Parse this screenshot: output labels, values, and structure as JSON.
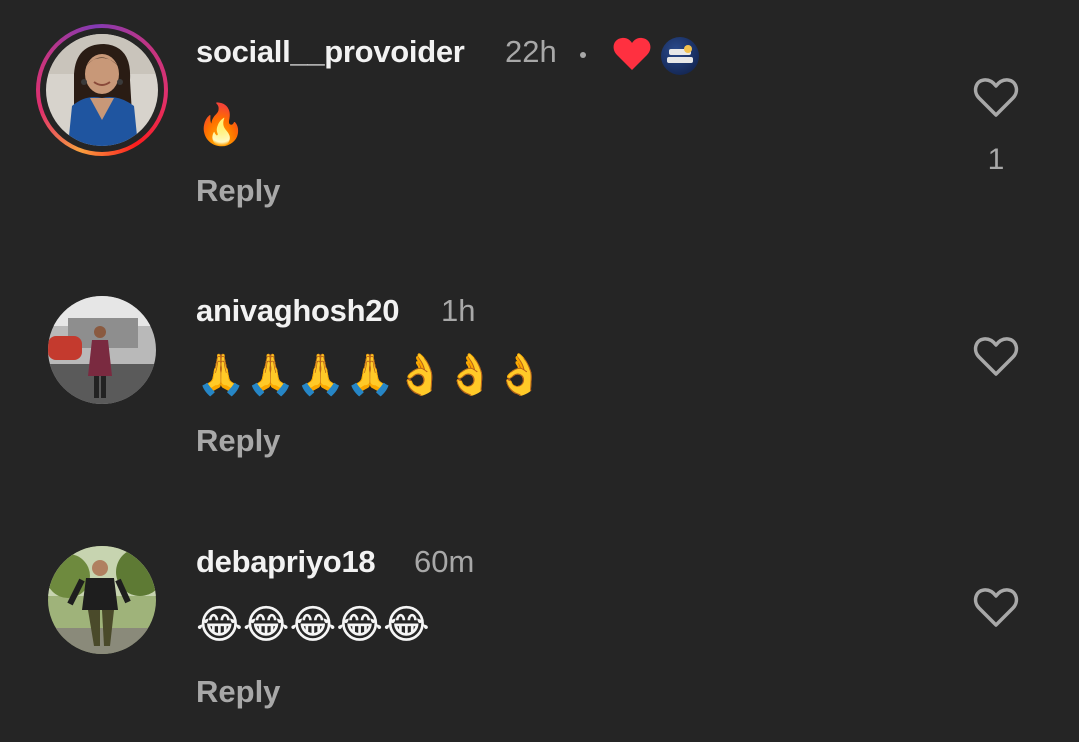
{
  "comments": [
    {
      "username": "sociall__provoider",
      "time": "22h",
      "text": "🔥",
      "reply_label": "Reply",
      "like_count": "1",
      "liked_by_creator": true
    },
    {
      "username": "anivaghosh20",
      "time": "1h",
      "text": "🙏🙏🙏🙏👌👌👌",
      "reply_label": "Reply",
      "like_count": ""
    },
    {
      "username": "debapriyo18",
      "time": "60m",
      "text": "😂😂😂😂😂",
      "reply_label": "Reply",
      "like_count": ""
    }
  ],
  "icons": {
    "like": "heart-outline-icon",
    "creator_like": "heart-filled-icon"
  },
  "colors": {
    "background": "#252525",
    "primary_text": "#f2f2f2",
    "secondary_text": "#a8a8a8",
    "heart_red": "#ff3040"
  }
}
